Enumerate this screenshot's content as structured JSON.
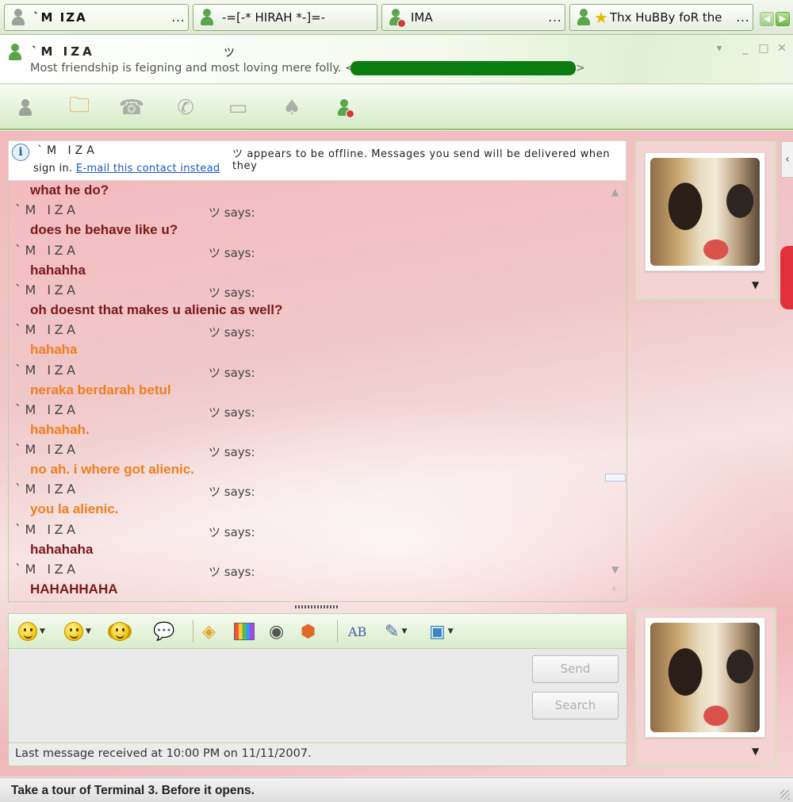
{
  "tabs": [
    {
      "label": "`M IZA",
      "ellipsis": "...",
      "icon": "contact-offline-icon",
      "active": true
    },
    {
      "label": "-=[-* HIRAH *-]=-",
      "ellipsis": "",
      "icon": "contact-online-icon"
    },
    {
      "label": "IMA",
      "ellipsis": "...",
      "icon": "contact-blocked-icon"
    },
    {
      "label": "Thx HuBBy foR the",
      "ellipsis": "...",
      "icon": "contact-online-icon"
    }
  ],
  "header": {
    "name": "`M IZA",
    "name_tail": "ツ",
    "personal_message": "Most friendship is feigning and most loving mere folly. <",
    "personal_message_end": ">"
  },
  "window_controls": {
    "options": "▾",
    "minimize": "_",
    "maximize": "□",
    "close": "✕"
  },
  "toolbar": {
    "items": [
      "invite-contact-icon",
      "send-files-icon",
      "start-call-icon",
      "call-phone-icon",
      "video-icon",
      "games-icon",
      "block-contact-icon"
    ]
  },
  "notice": {
    "info_glyph": "i",
    "name": "`M IZA",
    "message_line1": "ツ appears to be offline. Messages you send will be delivered when they",
    "message_line2_prefix": "sign in. ",
    "link_text": "E-mail this contact instead"
  },
  "conversation": {
    "messages": [
      {
        "sender": "",
        "text": "what he do?",
        "color": "#7a1919"
      },
      {
        "sender": "`M IZA",
        "says": "ツ says:",
        "text": "does he behave like u?",
        "color": "#7a1919"
      },
      {
        "sender": "`M IZA",
        "says": "ツ says:",
        "text": "hahahha",
        "color": "#7a1919"
      },
      {
        "sender": "`M IZA",
        "says": "ツ says:",
        "text": "oh doesnt that makes u alienic as well?",
        "color": "#7a1919"
      },
      {
        "sender": "`M IZA",
        "says": "ツ says:",
        "text": "hahaha",
        "color": "#ee7f1f"
      },
      {
        "sender": "`M IZA",
        "says": "ツ says:",
        "text": "neraka berdarah betul",
        "color": "#ee7f1f"
      },
      {
        "sender": "`M IZA",
        "says": "ツ says:",
        "text": "hahahah.",
        "color": "#ee7f1f"
      },
      {
        "sender": "`M IZA",
        "says": "ツ says:",
        "text": "no ah. i where got alienic.",
        "color": "#ee7f1f"
      },
      {
        "sender": "`M IZA",
        "says": "ツ says:",
        "text": "you la alienic.",
        "color": "#ee7f1f"
      },
      {
        "sender": "`M IZA",
        "says": "ツ says:",
        "text": "hahahaha",
        "color": "#7a1919"
      },
      {
        "sender": "`M IZA",
        "says": "ツ says:",
        "text": "HAHAHHAHA",
        "color": "#7a1919"
      }
    ]
  },
  "format_toolbar": {
    "items": [
      "emoticon-icon",
      "wink-icon",
      "nudge-icon",
      "voice-clip-icon",
      "background-icon",
      "grid-icon",
      "sound-icon",
      "gift-icon",
      "font-icon",
      "paint-brush-icon",
      "display-picture-icon"
    ]
  },
  "input": {
    "value": "",
    "placeholder": ""
  },
  "buttons": {
    "send": "Send",
    "search": "Search"
  },
  "status_bar": {
    "last_message": "Last message received at 10:00 PM on 11/11/2007."
  },
  "footer": {
    "ad_text": "Take a tour of Terminal 3. Before it opens."
  },
  "colors": {
    "accent_green": "#5aa64a",
    "message_dark": "#7a1919",
    "message_orange": "#ee7f1f",
    "link_blue": "#1a55c4"
  }
}
